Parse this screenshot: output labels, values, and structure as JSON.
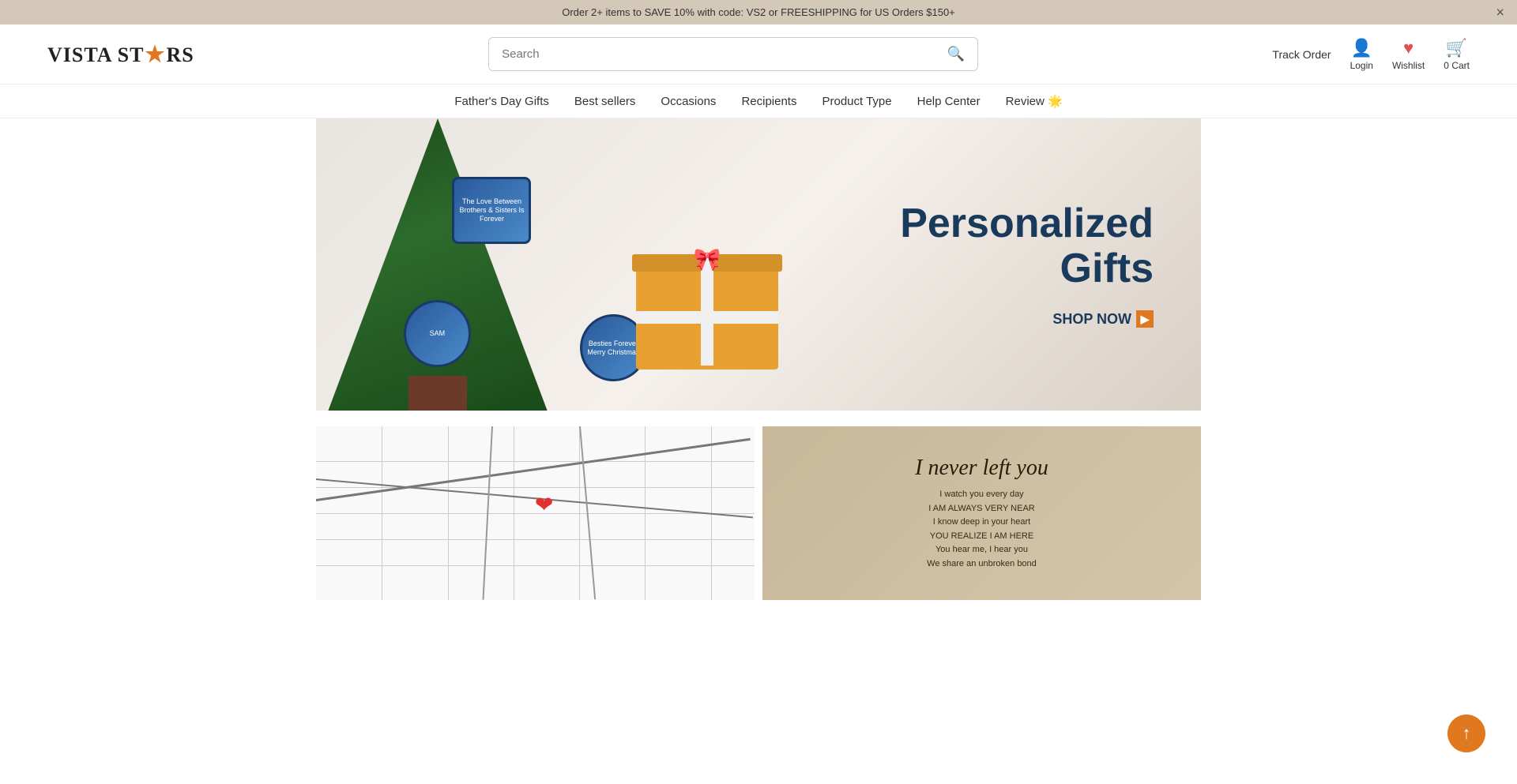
{
  "announcement": {
    "text": "Order 2+ items to SAVE 10% with code: VS2 or FREESHIPPING for US Orders $150+",
    "close_label": "×"
  },
  "logo": {
    "part1": "VISTA ST",
    "star": "★",
    "part2": "RS"
  },
  "search": {
    "placeholder": "Search"
  },
  "header": {
    "track_order": "Track Order",
    "login": "Login",
    "wishlist": "Wishlist",
    "cart": "Cart",
    "cart_count": "0"
  },
  "nav": {
    "items": [
      {
        "label": "Father's Day Gifts",
        "id": "fathers-day"
      },
      {
        "label": "Best sellers",
        "id": "best-sellers"
      },
      {
        "label": "Occasions",
        "id": "occasions"
      },
      {
        "label": "Recipients",
        "id": "recipients"
      },
      {
        "label": "Product Type",
        "id": "product-type"
      },
      {
        "label": "Help Center",
        "id": "help-center"
      },
      {
        "label": "Review 🌟",
        "id": "review"
      }
    ]
  },
  "hero": {
    "title": "Personalized Gifts",
    "shop_now": "SHOP NOW",
    "ornament1_text": "The Love Between Brothers & Sisters Is Forever",
    "ornament2_text": "SAM",
    "ornament3_text": "Besties Forever Merry Christmas"
  },
  "products": {
    "map_card_alt": "Custom City Map",
    "canvas_main_text": "I never left you",
    "canvas_sub_lines": [
      "I watch you every day",
      "I AM ALWAYS VERY NEAR",
      "I know deep in your heart",
      "YOU REALIZE I AM HERE",
      "You hear me, I hear you",
      "We share an unbroken bond"
    ]
  },
  "scroll_top_label": "↑"
}
